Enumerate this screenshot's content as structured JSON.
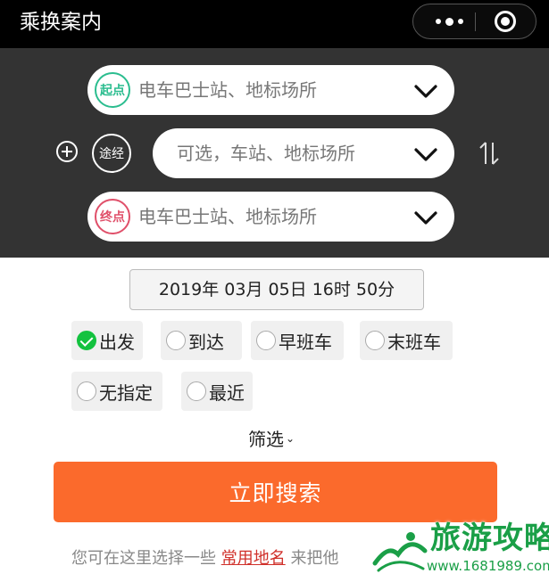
{
  "window": {
    "title": "乘换案内"
  },
  "capsule": {
    "more_icon": "more-dots-icon",
    "close_icon": "target-icon"
  },
  "route": {
    "start": {
      "badge": "起点",
      "placeholder": "电车巴士站、地标场所",
      "badge_color": "#2bbd8f"
    },
    "via": {
      "badge": "途经",
      "placeholder": "可选，车站、地标场所"
    },
    "end": {
      "badge": "终点",
      "placeholder": "电车巴士站、地标场所",
      "badge_color": "#e0506a"
    }
  },
  "datetime": {
    "value": "2019年 03月 05日 16时 50分"
  },
  "options": [
    {
      "label": "出发",
      "checked": true
    },
    {
      "label": "到达",
      "checked": false
    },
    {
      "label": "早班车",
      "checked": false
    },
    {
      "label": "末班车",
      "checked": false
    },
    {
      "label": "无指定",
      "checked": false
    },
    {
      "label": "最近",
      "checked": false
    }
  ],
  "filter": {
    "label": "筛选",
    "caret": "⌄"
  },
  "search": {
    "label": "立即搜索",
    "color": "#fb6a2c"
  },
  "footnote": {
    "prefix": "您可在这里选择一些",
    "link": "常用地名",
    "suffix": "来把他"
  },
  "watermark": {
    "title": "旅游攻略",
    "url": "www.1681989.com"
  },
  "colors": {
    "header_bg": "#333333",
    "accent_green": "#13c23f",
    "link_red": "#d0302a"
  }
}
